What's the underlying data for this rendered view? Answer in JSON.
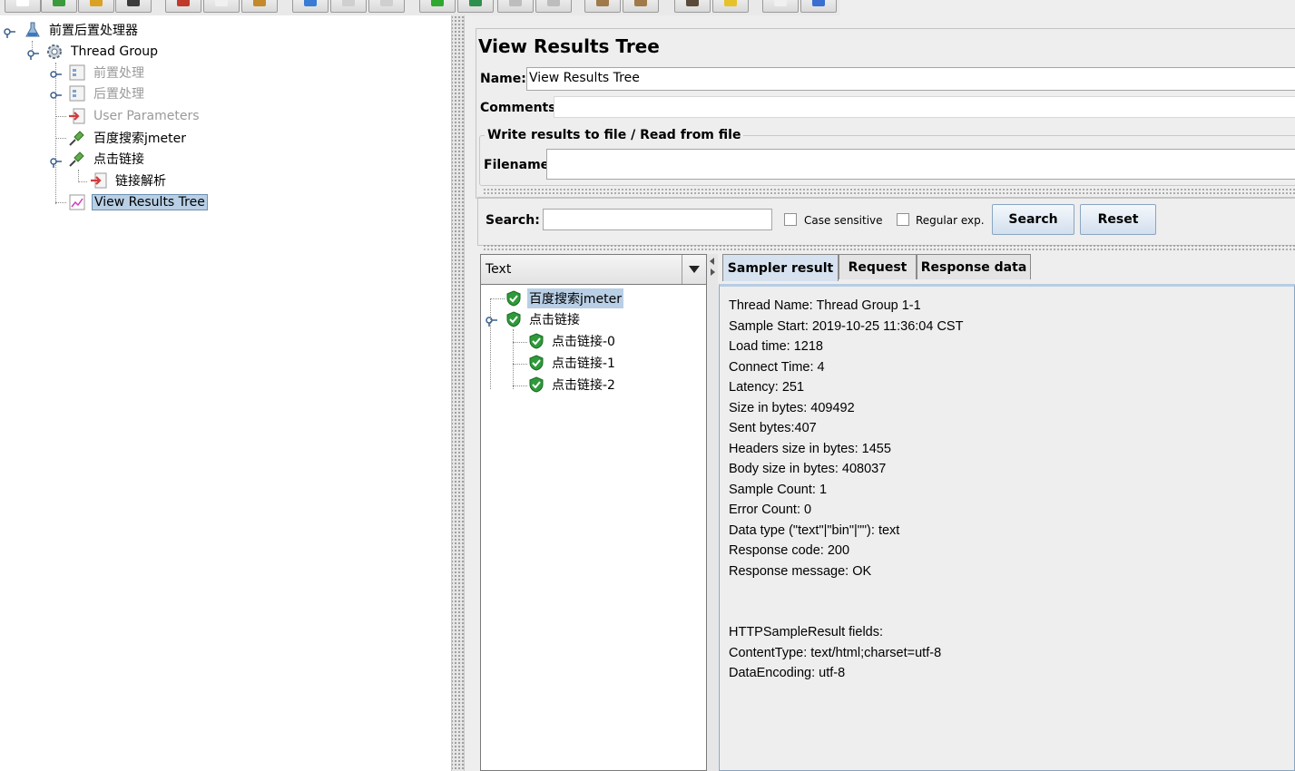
{
  "toolbar": {
    "buttons": [
      {
        "name": "new-icon",
        "color": "#ffffff"
      },
      {
        "name": "templates-icon",
        "color": "#3b9a3b"
      },
      {
        "name": "open-icon",
        "color": "#d9a126"
      },
      {
        "name": "save-icon",
        "color": "#3c3c3c"
      },
      {
        "name": "cut-icon",
        "color": "#c0392b"
      },
      {
        "name": "copy-icon",
        "color": "#f0f0f0"
      },
      {
        "name": "paste-icon",
        "color": "#c48a2a"
      },
      {
        "name": "expand-icon",
        "color": "#3a7bd5"
      },
      {
        "name": "collapse-icon",
        "color": "#cfcfcf"
      },
      {
        "name": "toggle-icon",
        "color": "#cfcfcf"
      },
      {
        "name": "start-icon",
        "color": "#2fa82f"
      },
      {
        "name": "start-no-pause-icon",
        "color": "#2f8f4f"
      },
      {
        "name": "stop-icon",
        "color": "#bdbdbd"
      },
      {
        "name": "shutdown-icon",
        "color": "#bdbdbd"
      },
      {
        "name": "clear-icon",
        "color": "#a07a4a"
      },
      {
        "name": "clear-all-icon",
        "color": "#a07a4a"
      },
      {
        "name": "search-tree-icon",
        "color": "#5a4a3a"
      },
      {
        "name": "reset-search-icon",
        "color": "#e6c22a"
      },
      {
        "name": "function-helper-icon",
        "color": "#f0f0f0"
      },
      {
        "name": "help-icon",
        "color": "#3a6fd0"
      }
    ]
  },
  "test_plan_tree": {
    "nodes": [
      {
        "label": "前置后置处理器",
        "icon": "test-plan-icon",
        "disabled": false
      },
      {
        "label": "Thread Group",
        "icon": "thread-group-icon",
        "disabled": false
      },
      {
        "label": "前置处理",
        "icon": "transaction-controller-icon",
        "disabled": true
      },
      {
        "label": "后置处理",
        "icon": "transaction-controller-icon",
        "disabled": true
      },
      {
        "label": "User Parameters",
        "icon": "pre-processor-icon",
        "disabled": true
      },
      {
        "label": "百度搜索jmeter",
        "icon": "sampler-icon",
        "disabled": false
      },
      {
        "label": "点击链接",
        "icon": "sampler-icon",
        "disabled": false
      },
      {
        "label": "链接解析",
        "icon": "pre-processor-icon",
        "disabled": false
      },
      {
        "label": "View Results Tree",
        "icon": "listener-icon",
        "disabled": false,
        "selected": true
      }
    ]
  },
  "panel": {
    "title": "View Results Tree",
    "name_label": "Name:",
    "name_value": "View Results Tree",
    "comments_label": "Comments:",
    "comments_value": "",
    "file_group_title": "Write results to file / Read from file",
    "filename_label": "Filename",
    "filename_value": ""
  },
  "search": {
    "label": "Search:",
    "value": "",
    "case_sensitive_label": "Case sensitive",
    "case_sensitive_checked": false,
    "regex_label": "Regular exp.",
    "regex_checked": false,
    "search_button": "Search",
    "reset_button": "Reset"
  },
  "results": {
    "renderer": "Text",
    "samples": [
      {
        "label": "百度搜索jmeter",
        "status": "success",
        "selected": true
      },
      {
        "label": "点击链接",
        "status": "success"
      },
      {
        "label": "点击链接-0",
        "status": "success"
      },
      {
        "label": "点击链接-1",
        "status": "success"
      },
      {
        "label": "点击链接-2",
        "status": "success"
      }
    ],
    "tabs": [
      {
        "label": "Sampler result",
        "active": true
      },
      {
        "label": "Request",
        "active": false
      },
      {
        "label": "Response data",
        "active": false
      }
    ],
    "sampler_result_lines": [
      "Thread Name: Thread Group 1-1",
      "Sample Start: 2019-10-25 11:36:04 CST",
      "Load time: 1218",
      "Connect Time: 4",
      "Latency: 251",
      "Size in bytes: 409492",
      "Sent bytes:407",
      "Headers size in bytes: 1455",
      "Body size in bytes: 408037",
      "Sample Count: 1",
      "Error Count: 0",
      "Data type (\"text\"|\"bin\"|\"\"): text",
      "Response code: 200",
      "Response message: OK",
      "",
      "",
      "HTTPSampleResult fields:",
      "ContentType: text/html;charset=utf-8",
      "DataEncoding: utf-8"
    ]
  }
}
